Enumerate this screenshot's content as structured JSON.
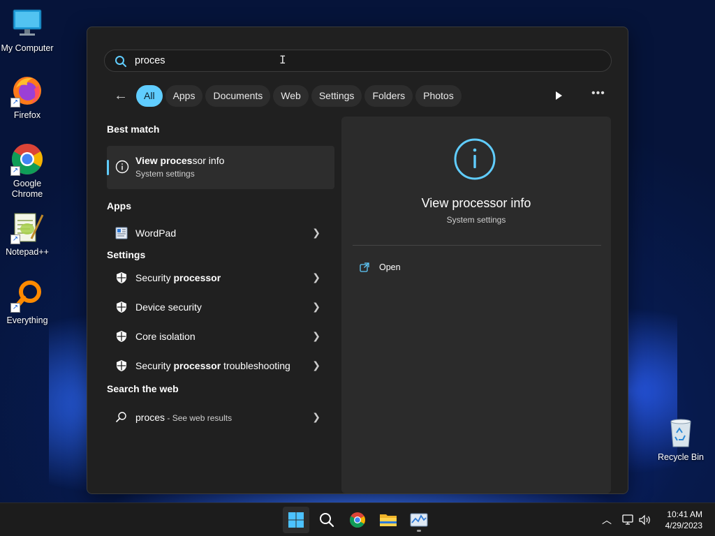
{
  "desktop": {
    "icons": [
      {
        "label": "My Computer",
        "icon": "monitor-icon"
      },
      {
        "label": "Firefox",
        "icon": "firefox-icon"
      },
      {
        "label": "Google Chrome",
        "icon": "chrome-icon"
      },
      {
        "label": "Notepad++",
        "icon": "notepadpp-icon"
      },
      {
        "label": "Everything",
        "icon": "everything-icon"
      },
      {
        "label": "Recycle Bin",
        "icon": "recycle-bin-icon"
      }
    ]
  },
  "search": {
    "query": "proces"
  },
  "filters": [
    "All",
    "Apps",
    "Documents",
    "Web",
    "Settings",
    "Folders",
    "Photos"
  ],
  "best_match": {
    "heading": "Best match",
    "title_bold": "View proces",
    "title_rest": "sor info",
    "subtitle": "System settings"
  },
  "apps": {
    "heading": "Apps",
    "items": [
      {
        "label": "WordPad"
      }
    ]
  },
  "settings": {
    "heading": "Settings",
    "items": [
      {
        "pre": "Security ",
        "bold": "processor",
        "post": ""
      },
      {
        "pre": "Device security",
        "bold": "",
        "post": ""
      },
      {
        "pre": "Core isolation",
        "bold": "",
        "post": ""
      },
      {
        "pre": "Security ",
        "bold": "processor",
        "post": " troubleshooting"
      }
    ]
  },
  "web": {
    "heading": "Search the web",
    "query": "proces",
    "suffix": " - See web results"
  },
  "preview": {
    "title": "View processor info",
    "subtitle": "System settings",
    "action": "Open"
  },
  "clock": {
    "time": "10:41 AM",
    "date": "4/29/2023"
  },
  "colors": {
    "accent": "#60cdff",
    "panel": "#202020"
  }
}
